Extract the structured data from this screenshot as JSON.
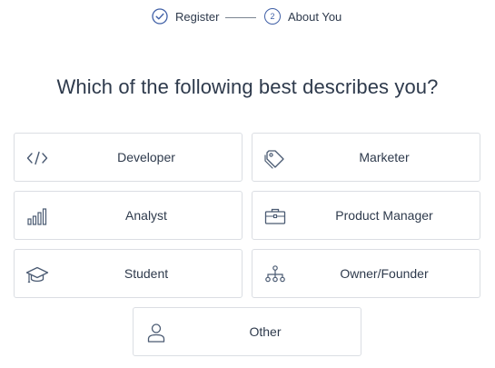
{
  "stepper": {
    "steps": [
      {
        "label": "Register",
        "state": "complete"
      },
      {
        "label": "About You",
        "number": "2",
        "state": "current"
      }
    ]
  },
  "heading": "Which of the following best describes you?",
  "options": [
    {
      "label": "Developer",
      "icon": "code-icon"
    },
    {
      "label": "Marketer",
      "icon": "tags-icon"
    },
    {
      "label": "Analyst",
      "icon": "bar-chart-icon"
    },
    {
      "label": "Product Manager",
      "icon": "briefcase-icon"
    },
    {
      "label": "Student",
      "icon": "graduation-cap-icon"
    },
    {
      "label": "Owner/Founder",
      "icon": "org-chart-icon"
    },
    {
      "label": "Other",
      "icon": "user-icon"
    }
  ],
  "colors": {
    "accent": "#3f5fa6",
    "text": "#2e3a4c",
    "border": "#dbdee3",
    "icon": "#4a5a72"
  }
}
